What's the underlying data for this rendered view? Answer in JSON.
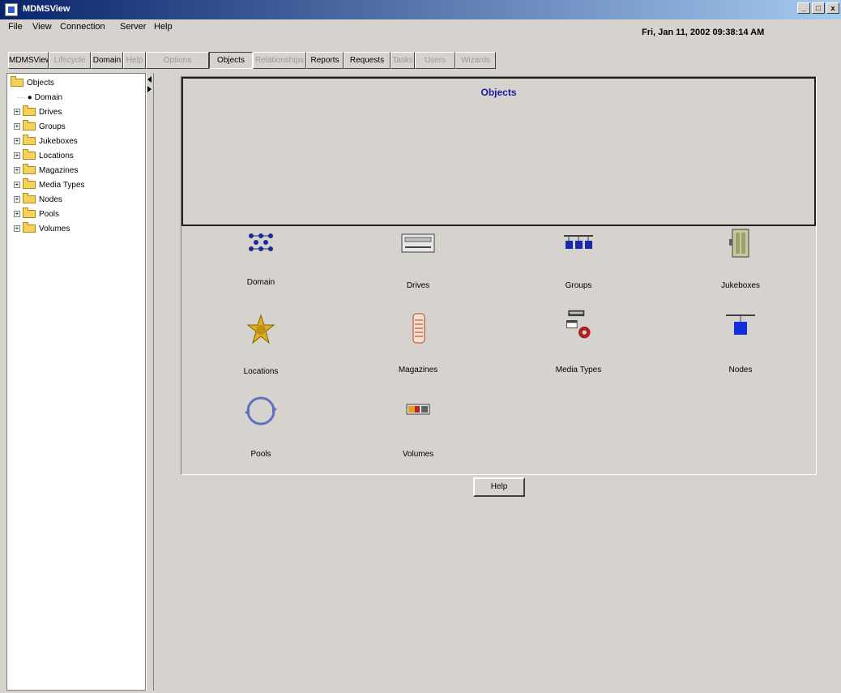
{
  "window": {
    "title": "MDMSView",
    "min": "_",
    "max": "□",
    "close": "x"
  },
  "menu": [
    "File",
    "View",
    "Connection",
    "Server",
    "Help"
  ],
  "clock": "Fri, Jan 11, 2002 09:38:14 AM",
  "tabs": [
    {
      "label": "MDMSView",
      "state": "normal"
    },
    {
      "label": "Lifecycle",
      "state": "disabled"
    },
    {
      "label": "Domain",
      "state": "normal"
    },
    {
      "label": "Help",
      "state": "disabled"
    },
    {
      "label": "Options",
      "state": "disabled"
    },
    {
      "label": "Objects",
      "state": "active"
    },
    {
      "label": "Relationships",
      "state": "disabled"
    },
    {
      "label": "Reports",
      "state": "normal"
    },
    {
      "label": "Requests",
      "state": "normal"
    },
    {
      "label": "Tasks",
      "state": "disabled"
    },
    {
      "label": "Users",
      "state": "disabled"
    },
    {
      "label": "Wizards",
      "state": "disabled"
    }
  ],
  "tree": {
    "root": "Objects",
    "items": [
      {
        "label": "Domain",
        "type": "leaf"
      },
      {
        "label": "Drives",
        "type": "folder"
      },
      {
        "label": "Groups",
        "type": "folder"
      },
      {
        "label": "Jukeboxes",
        "type": "folder"
      },
      {
        "label": "Locations",
        "type": "folder"
      },
      {
        "label": "Magazines",
        "type": "folder"
      },
      {
        "label": "Media Types",
        "type": "folder"
      },
      {
        "label": "Nodes",
        "type": "folder"
      },
      {
        "label": "Pools",
        "type": "folder"
      },
      {
        "label": "Volumes",
        "type": "folder"
      }
    ]
  },
  "panel": {
    "title": "Objects",
    "objects": [
      {
        "label": "Domain",
        "icon": "domain-icon"
      },
      {
        "label": "Drives",
        "icon": "drives-icon"
      },
      {
        "label": "Groups",
        "icon": "groups-icon"
      },
      {
        "label": "Jukeboxes",
        "icon": "jukeboxes-icon"
      },
      {
        "label": "Locations",
        "icon": "locations-icon"
      },
      {
        "label": "Magazines",
        "icon": "magazines-icon"
      },
      {
        "label": "Media Types",
        "icon": "media-types-icon"
      },
      {
        "label": "Nodes",
        "icon": "nodes-icon"
      },
      {
        "label": "Pools",
        "icon": "pools-icon"
      },
      {
        "label": "Volumes",
        "icon": "volumes-icon"
      }
    ]
  },
  "help_button": "Help"
}
